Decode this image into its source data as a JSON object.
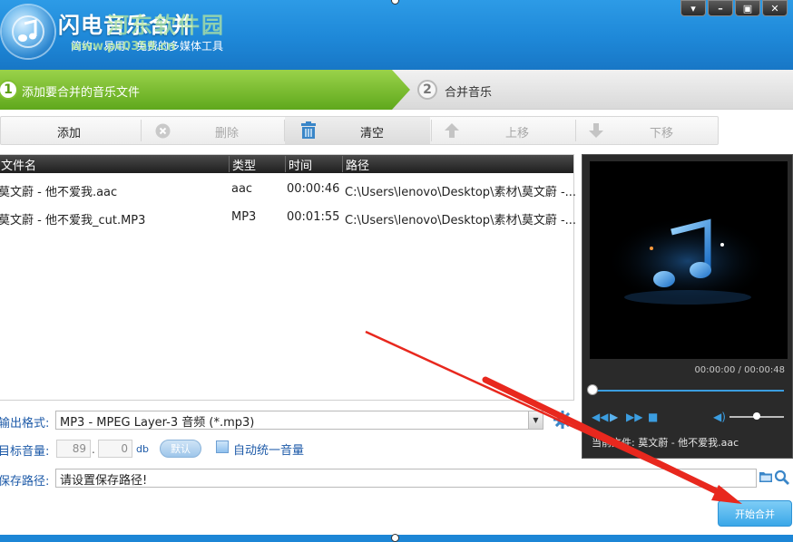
{
  "header": {
    "title": "闪电音乐合并",
    "watermark_text": "河东软件园",
    "subtitle": "简约、易用、免费的多媒体工具",
    "watermark_url": "www.pc0359.cn",
    "window_controls": [
      "▾",
      "–",
      "▣",
      "✕"
    ]
  },
  "steps": [
    {
      "number": "1",
      "label": "添加要合并的音乐文件",
      "active": true
    },
    {
      "number": "2",
      "label": "合并音乐",
      "active": false
    }
  ],
  "toolbar": {
    "add_label": "添加",
    "delete_label": "删除",
    "clear_label": "清空",
    "move_up_label": "上移",
    "move_down_label": "下移"
  },
  "file_table": {
    "columns": [
      "文件名",
      "类型",
      "时间",
      "路径"
    ],
    "rows": [
      {
        "name": "莫文蔚 - 他不爱我.aac",
        "type": "aac",
        "time": "00:00:46",
        "path": "C:\\Users\\lenovo\\Desktop\\素材\\莫文蔚 -..."
      },
      {
        "name": "莫文蔚 - 他不爱我_cut.MP3",
        "type": "MP3",
        "time": "00:01:55",
        "path": "C:\\Users\\lenovo\\Desktop\\素材\\莫文蔚 -..."
      }
    ]
  },
  "player": {
    "time": "00:00:00 / 00:00:48",
    "current_file": "当前文件: 莫文蔚 - 他不爱我.aac",
    "progress": 0,
    "volume": 0.45
  },
  "settings": {
    "format_label": "输出格式:",
    "format_value": "MP3 - MPEG Layer-3 音频 (*.mp3)",
    "volume_label": "目标音量:",
    "volume_int": "89",
    "volume_dec": "0",
    "volume_unit": "db",
    "default_label": "默认",
    "auto_volume_label": "自动统一音量",
    "path_label": "保存路径:",
    "path_value": "请设置保存路径!"
  },
  "start_label": "开始合并",
  "colors": {
    "header_blue": "#1e88d8",
    "step_green": "#7fc030",
    "accent_blue": "#3b9de0",
    "arrow_red": "#e8281e"
  }
}
